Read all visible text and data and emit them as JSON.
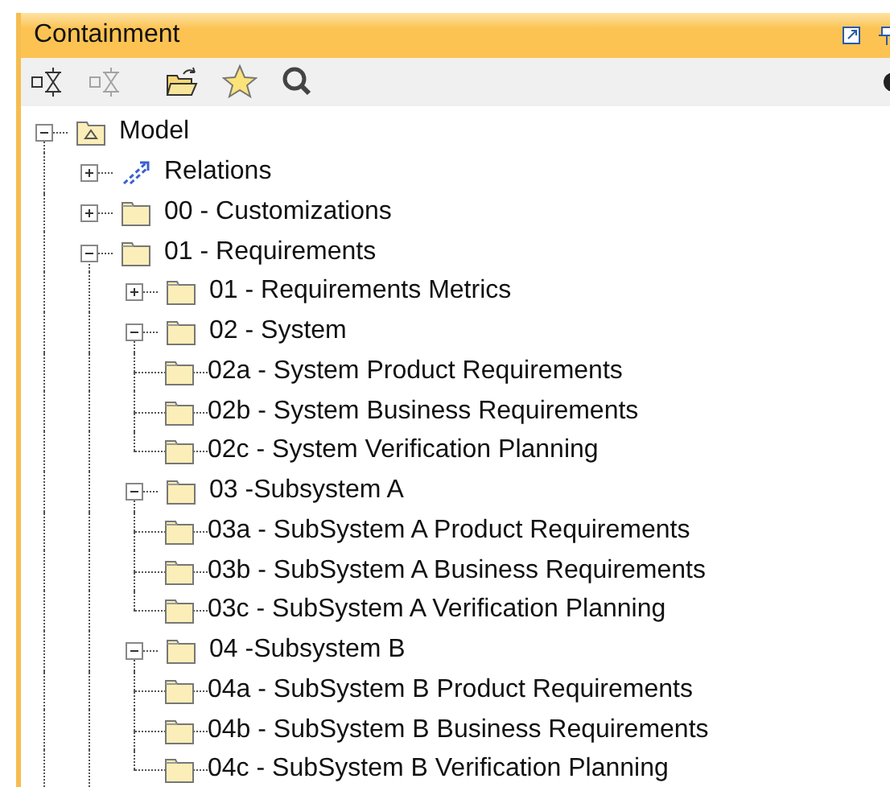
{
  "panel": {
    "title": "Containment"
  },
  "toolbar": [
    {
      "kind": "collapse",
      "disabled": false
    },
    {
      "kind": "collapse",
      "disabled": true
    },
    {
      "kind": "open",
      "disabled": false
    },
    {
      "kind": "favorite",
      "disabled": false
    },
    {
      "kind": "search",
      "disabled": false
    }
  ],
  "tree": [
    {
      "label": "Model",
      "kind": "model",
      "expanded": true,
      "children": [
        {
          "label": "Relations",
          "kind": "relations",
          "expanded": false
        },
        {
          "label": "00 - Customizations",
          "kind": "folder",
          "expanded": false
        },
        {
          "label": "01 - Requirements",
          "kind": "folder",
          "expanded": true,
          "children": [
            {
              "label": "01 - Requirements Metrics",
              "kind": "folder",
              "expanded": false
            },
            {
              "label": "02 - System",
              "kind": "folder",
              "expanded": true,
              "children": [
                {
                  "label": "02a - System Product Requirements",
                  "kind": "folder"
                },
                {
                  "label": "02b - System Business Requirements",
                  "kind": "folder"
                },
                {
                  "label": "02c - System Verification Planning",
                  "kind": "folder"
                }
              ]
            },
            {
              "label": "03 -Subsystem A",
              "kind": "folder",
              "expanded": true,
              "children": [
                {
                  "label": "03a - SubSystem A Product Requirements",
                  "kind": "folder"
                },
                {
                  "label": "03b - SubSystem A Business Requirements",
                  "kind": "folder"
                },
                {
                  "label": "03c - SubSystem A Verification Planning",
                  "kind": "folder"
                }
              ]
            },
            {
              "label": "04 -Subsystem B",
              "kind": "folder",
              "expanded": true,
              "children": [
                {
                  "label": "04a - SubSystem B Product Requirements",
                  "kind": "folder"
                },
                {
                  "label": "04b - SubSystem B Business Requirements",
                  "kind": "folder"
                },
                {
                  "label": "04c - SubSystem B Verification Planning",
                  "kind": "folder"
                }
              ]
            }
          ]
        }
      ]
    }
  ]
}
